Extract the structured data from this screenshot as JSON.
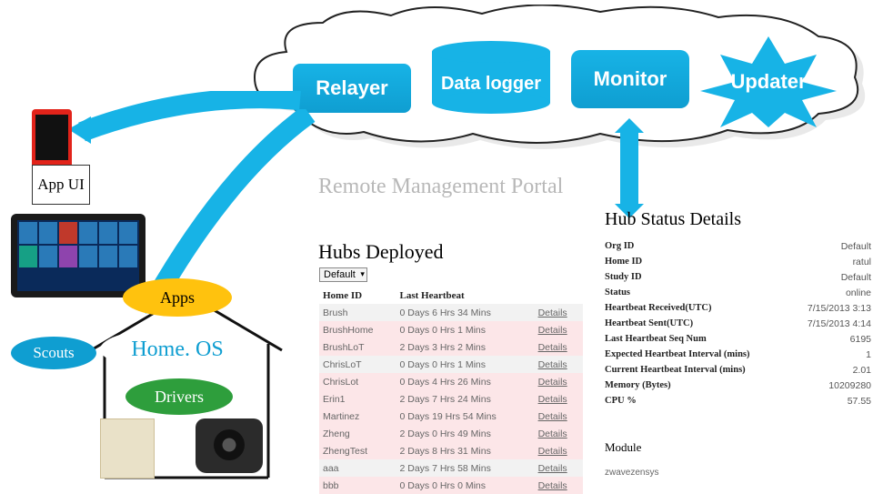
{
  "cloud": {
    "relayer": "Relayer",
    "datalogger": "Data logger",
    "monitor": "Monitor",
    "updater": "Updater"
  },
  "left": {
    "app_ui": "App UI",
    "apps": "Apps",
    "homeos": "Home. OS",
    "drivers": "Drivers",
    "scouts": "Scouts"
  },
  "portal": {
    "title": "Remote Management Portal",
    "hubs_title": "Hubs Deployed",
    "filter": "Default",
    "col_home": "Home ID",
    "col_hb": "Last Heartbeat",
    "details": "Details",
    "rows": [
      {
        "id": "Brush",
        "hb": "0 Days 6 Hrs 34 Mins"
      },
      {
        "id": "BrushHome",
        "hb": "0 Days 0 Hrs 1 Mins"
      },
      {
        "id": "BrushLoT",
        "hb": "2 Days 3 Hrs 2 Mins"
      },
      {
        "id": "ChrisLoT",
        "hb": "0 Days 0 Hrs 1 Mins"
      },
      {
        "id": "ChrisLot",
        "hb": "0 Days 4 Hrs 26 Mins"
      },
      {
        "id": "Erin1",
        "hb": "2 Days 7 Hrs 24 Mins"
      },
      {
        "id": "Martinez",
        "hb": "0 Days 19 Hrs 54 Mins"
      },
      {
        "id": "Zheng",
        "hb": "2 Days 0 Hrs 49 Mins"
      },
      {
        "id": "ZhengTest",
        "hb": "2 Days 8 Hrs 31 Mins"
      },
      {
        "id": "aaa",
        "hb": "2 Days 7 Hrs 58 Mins"
      },
      {
        "id": "bbb",
        "hb": "0 Days 0 Hrs 0 Mins"
      }
    ]
  },
  "status": {
    "title": "Hub Status Details",
    "kv": [
      {
        "k": "Org ID",
        "v": "Default"
      },
      {
        "k": "Home ID",
        "v": "ratul"
      },
      {
        "k": "Study ID",
        "v": "Default"
      },
      {
        "k": "Status",
        "v": "online"
      },
      {
        "k": "Heartbeat Received(UTC)",
        "v": "7/15/2013 3:13"
      },
      {
        "k": "Heartbeat Sent(UTC)",
        "v": "7/15/2013 4:14"
      },
      {
        "k": "Last Heartbeat Seq Num",
        "v": "6195"
      },
      {
        "k": "Expected Heartbeat Interval (mins)",
        "v": "1"
      },
      {
        "k": "Current Heartbeat Interval (mins)",
        "v": "2.01"
      },
      {
        "k": "Memory (Bytes)",
        "v": "10209280"
      },
      {
        "k": "CPU %",
        "v": "57.55"
      }
    ],
    "module": "Module",
    "module_val": "zwavezensys"
  }
}
